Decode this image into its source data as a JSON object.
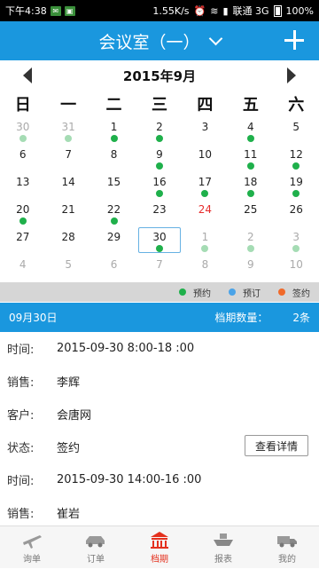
{
  "statusbar": {
    "time": "下午4:38",
    "speed": "1.55K/s",
    "carrier": "联通 3G",
    "battery": "100%"
  },
  "header": {
    "title": "会议室（一）",
    "add_icon": "plus-icon",
    "dropdown_icon": "chevron-down-icon"
  },
  "calendar": {
    "month_title": "2015年9月",
    "weekdays": [
      "日",
      "一",
      "二",
      "三",
      "四",
      "五",
      "六"
    ],
    "weeks": [
      [
        {
          "d": "30",
          "other": true,
          "dot": true
        },
        {
          "d": "31",
          "other": true,
          "dot": true
        },
        {
          "d": "1",
          "dot": true
        },
        {
          "d": "2",
          "dot": true
        },
        {
          "d": "3"
        },
        {
          "d": "4",
          "dot": true
        },
        {
          "d": "5"
        }
      ],
      [
        {
          "d": "6"
        },
        {
          "d": "7"
        },
        {
          "d": "8"
        },
        {
          "d": "9",
          "dot": true
        },
        {
          "d": "10"
        },
        {
          "d": "11",
          "dot": true
        },
        {
          "d": "12",
          "dot": true
        }
      ],
      [
        {
          "d": "13"
        },
        {
          "d": "14"
        },
        {
          "d": "15"
        },
        {
          "d": "16",
          "dot": true
        },
        {
          "d": "17",
          "dot": true
        },
        {
          "d": "18",
          "dot": true
        },
        {
          "d": "19",
          "dot": true
        }
      ],
      [
        {
          "d": "20",
          "dot": true
        },
        {
          "d": "21"
        },
        {
          "d": "22",
          "dot": true
        },
        {
          "d": "23"
        },
        {
          "d": "24",
          "today": true
        },
        {
          "d": "25"
        },
        {
          "d": "26"
        }
      ],
      [
        {
          "d": "27"
        },
        {
          "d": "28"
        },
        {
          "d": "29"
        },
        {
          "d": "30",
          "selected": true,
          "dot": true
        },
        {
          "d": "1",
          "other": true,
          "dot": true
        },
        {
          "d": "2",
          "other": true,
          "dot": true
        },
        {
          "d": "3",
          "other": true,
          "dot": true
        }
      ],
      [
        {
          "d": "4",
          "other": true
        },
        {
          "d": "5",
          "other": true
        },
        {
          "d": "6",
          "other": true
        },
        {
          "d": "7",
          "other": true
        },
        {
          "d": "8",
          "other": true
        },
        {
          "d": "9",
          "other": true
        },
        {
          "d": "10",
          "other": true
        }
      ]
    ]
  },
  "legend": [
    {
      "label": "预约",
      "color": "#1fb04b"
    },
    {
      "label": "预订",
      "color": "#4aa3e8"
    },
    {
      "label": "签约",
      "color": "#f06a2a"
    }
  ],
  "infobar": {
    "date": "09月30日",
    "count_label": "档期数量：",
    "count_value": "2条"
  },
  "details": [
    {
      "label": "时间:",
      "value": "2015-09-30 8:00-18 :00"
    },
    {
      "label": "销售:",
      "value": "李辉"
    },
    {
      "label": "客户:",
      "value": "会唐网"
    },
    {
      "label": "状态:",
      "value": "签约",
      "button": "查看详情"
    },
    {
      "label": "时间:",
      "value": "2015-09-30 14:00-16 :00"
    },
    {
      "label": "销售:",
      "value": "崔岩"
    }
  ],
  "tabs": [
    {
      "label": "询单",
      "icon": "plane-icon"
    },
    {
      "label": "订单",
      "icon": "car-icon"
    },
    {
      "label": "档期",
      "icon": "building-icon",
      "active": true
    },
    {
      "label": "报表",
      "icon": "ship-icon"
    },
    {
      "label": "我的",
      "icon": "truck-icon"
    }
  ]
}
